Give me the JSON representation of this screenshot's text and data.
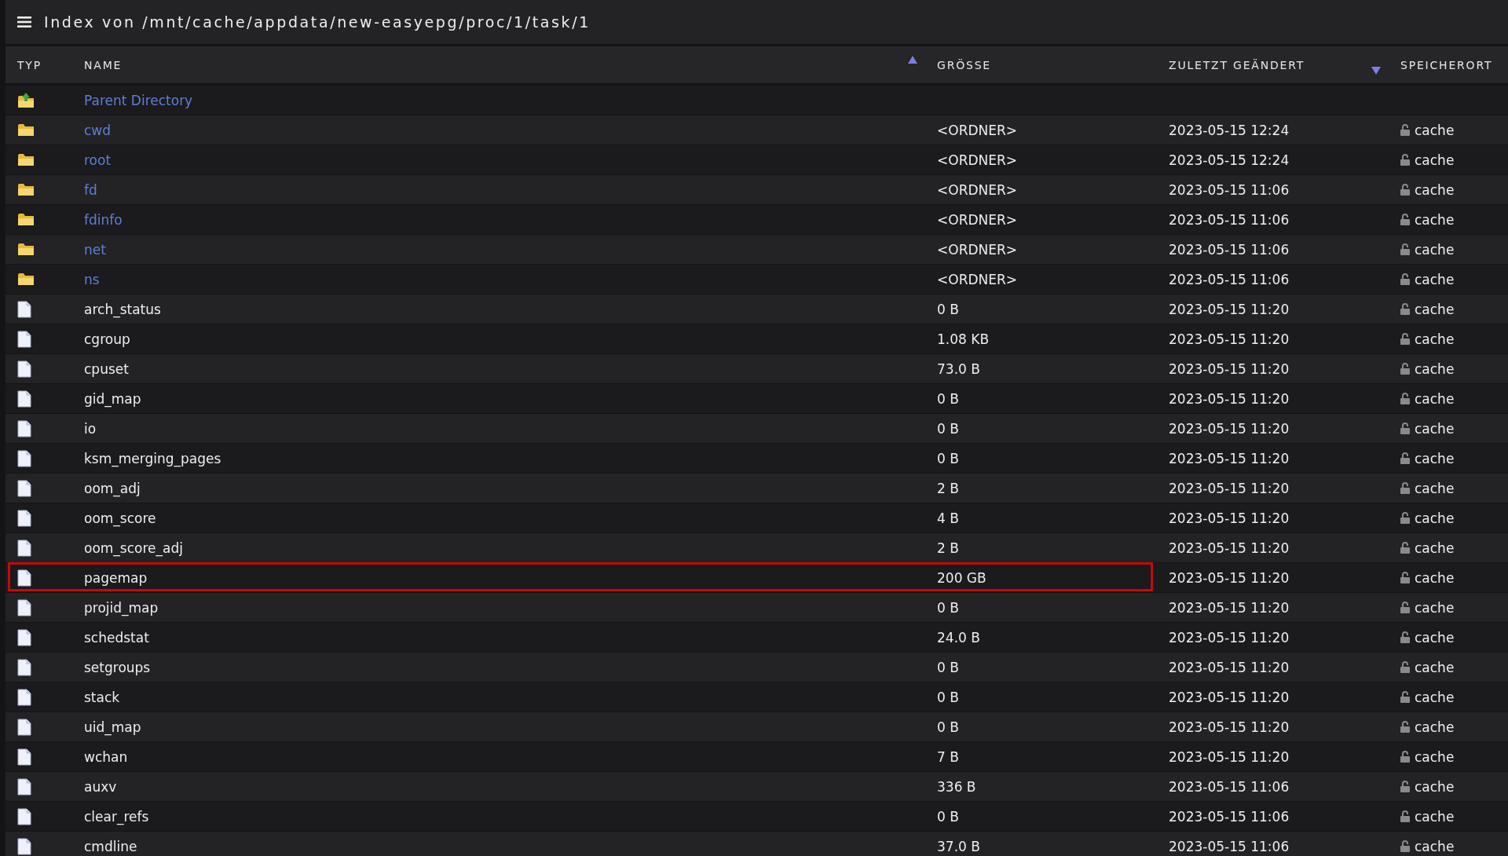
{
  "title": "Index von /mnt/cache/appdata/new-easyepg/proc/1/task/1",
  "columns": [
    {
      "label": "TYP",
      "sorted_ascending": false,
      "sorted_descending": false
    },
    {
      "label": "NAME",
      "sorted_ascending": true,
      "sorted_descending": false
    },
    {
      "label": "GRÖSSE",
      "sorted_ascending": false,
      "sorted_descending": false
    },
    {
      "label": "ZULETZT GEÄNDERT",
      "sorted_ascending": false,
      "sorted_descending": true
    },
    {
      "label": "SPEICHERORT",
      "sorted_ascending": false,
      "sorted_descending": false
    }
  ],
  "rows": [
    {
      "kind": "parent",
      "name": "Parent Directory",
      "highlighted": false
    },
    {
      "kind": "folder",
      "name": "cwd",
      "size": "<ORDNER>",
      "modified": "2023-05-15 12:24",
      "location": "cache",
      "highlighted": false
    },
    {
      "kind": "folder",
      "name": "root",
      "size": "<ORDNER>",
      "modified": "2023-05-15 12:24",
      "location": "cache",
      "highlighted": false
    },
    {
      "kind": "folder",
      "name": "fd",
      "size": "<ORDNER>",
      "modified": "2023-05-15 11:06",
      "location": "cache",
      "highlighted": false
    },
    {
      "kind": "folder",
      "name": "fdinfo",
      "size": "<ORDNER>",
      "modified": "2023-05-15 11:06",
      "location": "cache",
      "highlighted": false
    },
    {
      "kind": "folder",
      "name": "net",
      "size": "<ORDNER>",
      "modified": "2023-05-15 11:06",
      "location": "cache",
      "highlighted": false
    },
    {
      "kind": "folder",
      "name": "ns",
      "size": "<ORDNER>",
      "modified": "2023-05-15 11:06",
      "location": "cache",
      "highlighted": false
    },
    {
      "kind": "file",
      "name": "arch_status",
      "size": "0 B",
      "modified": "2023-05-15 11:20",
      "location": "cache",
      "highlighted": false
    },
    {
      "kind": "file",
      "name": "cgroup",
      "size": "1.08 KB",
      "modified": "2023-05-15 11:20",
      "location": "cache",
      "highlighted": false
    },
    {
      "kind": "file",
      "name": "cpuset",
      "size": "73.0 B",
      "modified": "2023-05-15 11:20",
      "location": "cache",
      "highlighted": false
    },
    {
      "kind": "file",
      "name": "gid_map",
      "size": "0 B",
      "modified": "2023-05-15 11:20",
      "location": "cache",
      "highlighted": false
    },
    {
      "kind": "file",
      "name": "io",
      "size": "0 B",
      "modified": "2023-05-15 11:20",
      "location": "cache",
      "highlighted": false
    },
    {
      "kind": "file",
      "name": "ksm_merging_pages",
      "size": "0 B",
      "modified": "2023-05-15 11:20",
      "location": "cache",
      "highlighted": false
    },
    {
      "kind": "file",
      "name": "oom_adj",
      "size": "2 B",
      "modified": "2023-05-15 11:20",
      "location": "cache",
      "highlighted": false
    },
    {
      "kind": "file",
      "name": "oom_score",
      "size": "4 B",
      "modified": "2023-05-15 11:20",
      "location": "cache",
      "highlighted": false
    },
    {
      "kind": "file",
      "name": "oom_score_adj",
      "size": "2 B",
      "modified": "2023-05-15 11:20",
      "location": "cache",
      "highlighted": false
    },
    {
      "kind": "file",
      "name": "pagemap",
      "size": "200 GB",
      "modified": "2023-05-15 11:20",
      "location": "cache",
      "highlighted": true
    },
    {
      "kind": "file",
      "name": "projid_map",
      "size": "0 B",
      "modified": "2023-05-15 11:20",
      "location": "cache",
      "highlighted": false
    },
    {
      "kind": "file",
      "name": "schedstat",
      "size": "24.0 B",
      "modified": "2023-05-15 11:20",
      "location": "cache",
      "highlighted": false
    },
    {
      "kind": "file",
      "name": "setgroups",
      "size": "0 B",
      "modified": "2023-05-15 11:20",
      "location": "cache",
      "highlighted": false
    },
    {
      "kind": "file",
      "name": "stack",
      "size": "0 B",
      "modified": "2023-05-15 11:20",
      "location": "cache",
      "highlighted": false
    },
    {
      "kind": "file",
      "name": "uid_map",
      "size": "0 B",
      "modified": "2023-05-15 11:20",
      "location": "cache",
      "highlighted": false
    },
    {
      "kind": "file",
      "name": "wchan",
      "size": "7 B",
      "modified": "2023-05-15 11:20",
      "location": "cache",
      "highlighted": false
    },
    {
      "kind": "file",
      "name": "auxv",
      "size": "336 B",
      "modified": "2023-05-15 11:06",
      "location": "cache",
      "highlighted": false
    },
    {
      "kind": "file",
      "name": "clear_refs",
      "size": "0 B",
      "modified": "2023-05-15 11:06",
      "location": "cache",
      "highlighted": false
    },
    {
      "kind": "file",
      "name": "cmdline",
      "size": "37.0 B",
      "modified": "2023-05-15 11:06",
      "location": "cache",
      "highlighted": false
    }
  ]
}
